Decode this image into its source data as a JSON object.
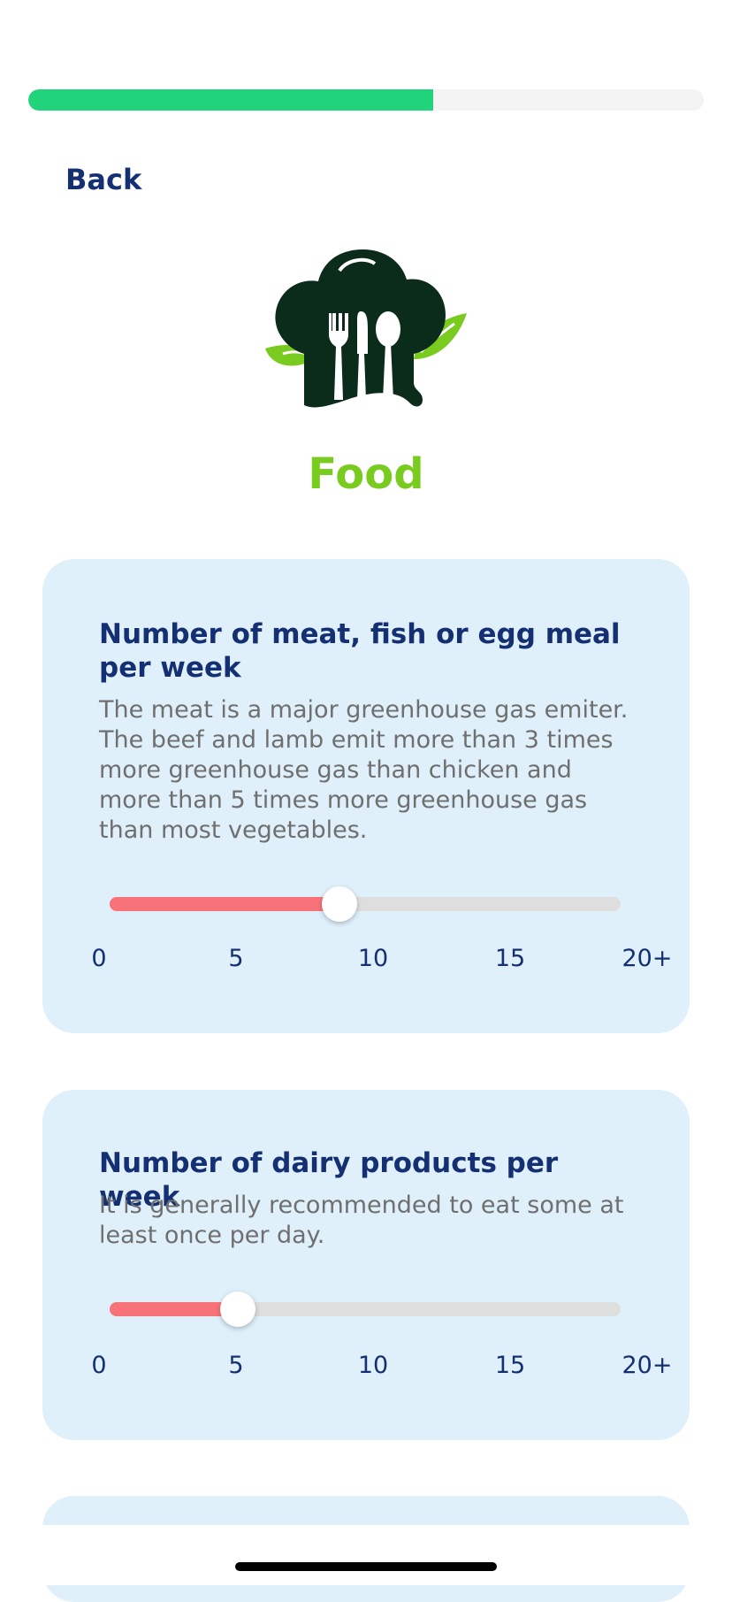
{
  "progress": {
    "fraction": 0.6,
    "color": "#21d37a"
  },
  "nav": {
    "back_label": "Back"
  },
  "section": {
    "title": "Food",
    "icon": "chef-hat-utensils-icon"
  },
  "questions": [
    {
      "title": "Number of meat, fish or egg meal per week",
      "description": "The meat is a major greenhouse gas emiter. The beef and lamb emit more than 3 times more greenhouse gas than chicken and more than 5 times more greenhouse gas than most vegetables.",
      "value": 9,
      "max": 20,
      "ticks": [
        "0",
        "5",
        "10",
        "15",
        "20+"
      ]
    },
    {
      "title": "Number of dairy products per week",
      "description": "It is generally recommended to eat some at least once per day.",
      "value": 5,
      "max": 20,
      "ticks": [
        "0",
        "5",
        "10",
        "15",
        "20+"
      ]
    }
  ],
  "colors": {
    "accent_green": "#7acb1f",
    "slider_fill": "#f87379",
    "card_bg": "#dff0fb",
    "text_navy": "#143073"
  }
}
